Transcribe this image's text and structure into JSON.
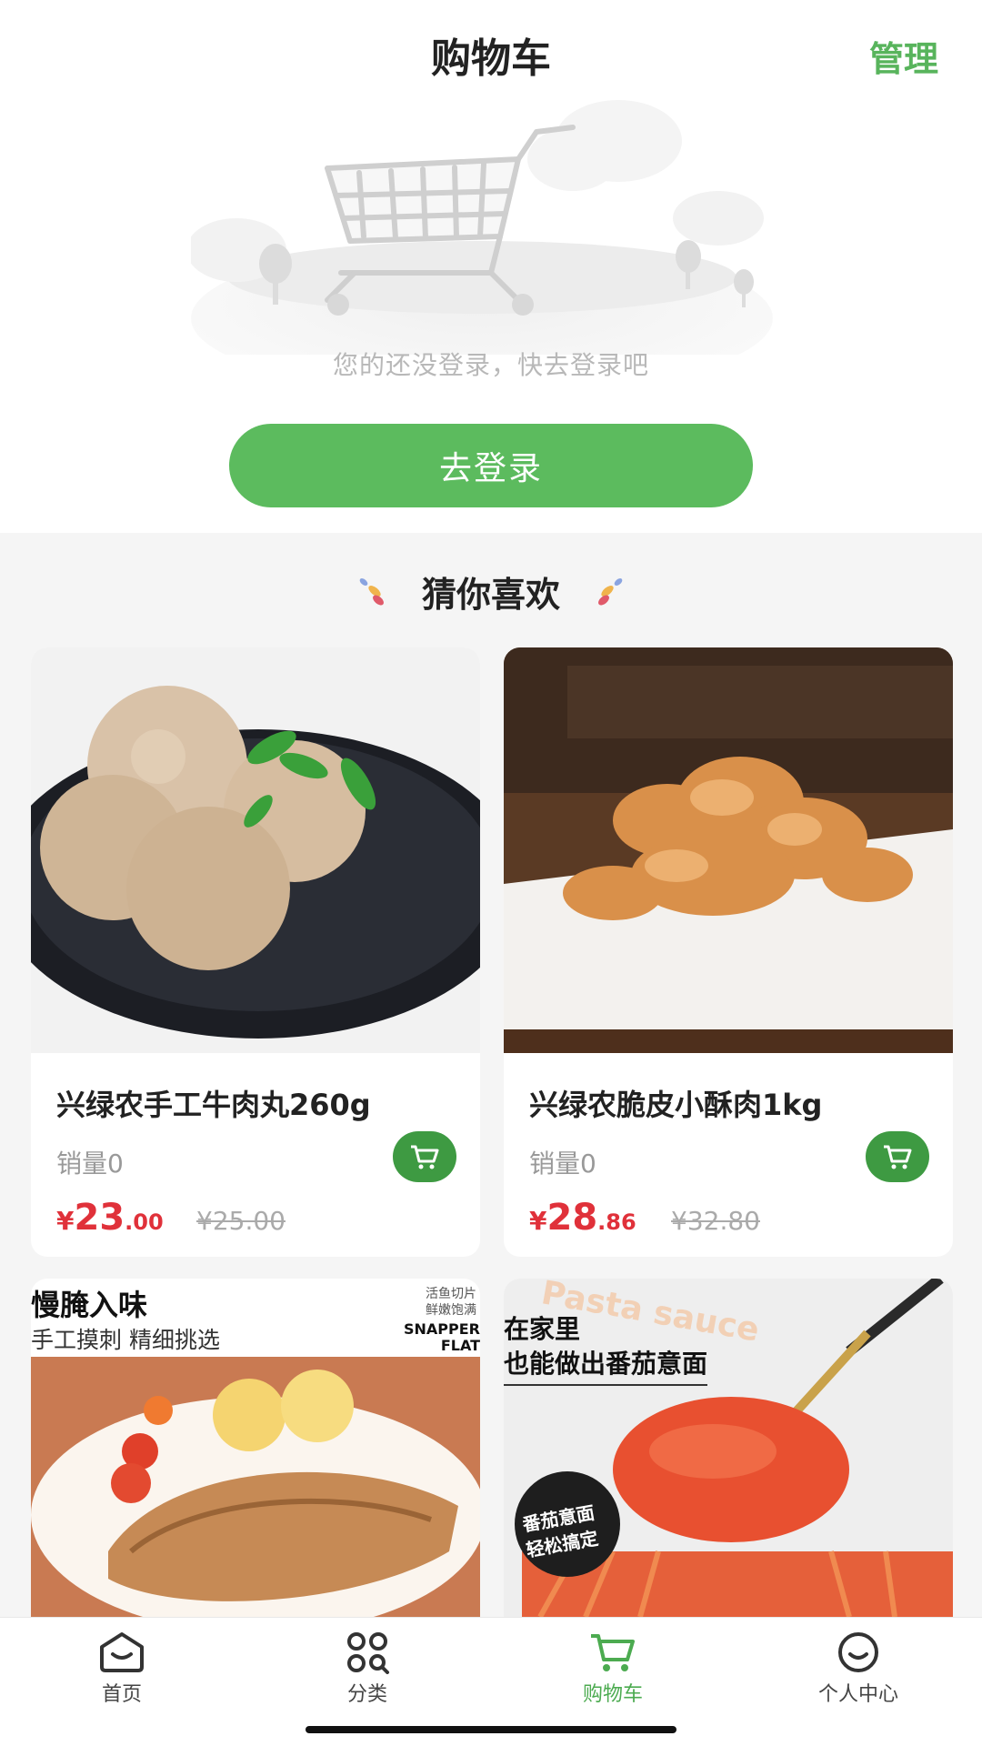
{
  "header": {
    "title": "购物车",
    "manage_label": "管理"
  },
  "empty_state": {
    "message": "您的还没登录，快去登录吧",
    "login_button": "去登录"
  },
  "recommend": {
    "title": "猜你喜欢"
  },
  "products": [
    {
      "name": "兴绿农手工牛肉丸260g",
      "sales": "销量0",
      "currency": "¥",
      "price_int": "23",
      "price_dec": ".00",
      "old_price": "¥25.00"
    },
    {
      "name": "兴绿农脆皮小酥肉1kg",
      "sales": "销量0",
      "currency": "¥",
      "price_int": "28",
      "price_dec": ".86",
      "old_price": "¥32.80"
    }
  ],
  "promo_banners": [
    {
      "headline": "慢腌入味",
      "subline": "手工摸刺 精细挑选",
      "tag_line1": "活鱼切片",
      "tag_line2": "鲜嫩饱满",
      "tag_en1": "SNAPPER",
      "tag_en2": "FLAT"
    },
    {
      "headline1": "在家里",
      "headline2": "也能做出番茄意面",
      "bg_word": "Pasta sauce",
      "badge_line1": "番茄意面",
      "badge_line2": "轻松搞定"
    }
  ],
  "tabbar": {
    "items": [
      {
        "label": "首页",
        "icon": "home-icon"
      },
      {
        "label": "分类",
        "icon": "category-icon"
      },
      {
        "label": "购物车",
        "icon": "cart-icon"
      },
      {
        "label": "个人中心",
        "icon": "profile-icon"
      }
    ],
    "active_index": 2
  },
  "colors": {
    "accent": "#5cbb5e",
    "price": "#e0313a",
    "active_tab": "#4cab50"
  }
}
